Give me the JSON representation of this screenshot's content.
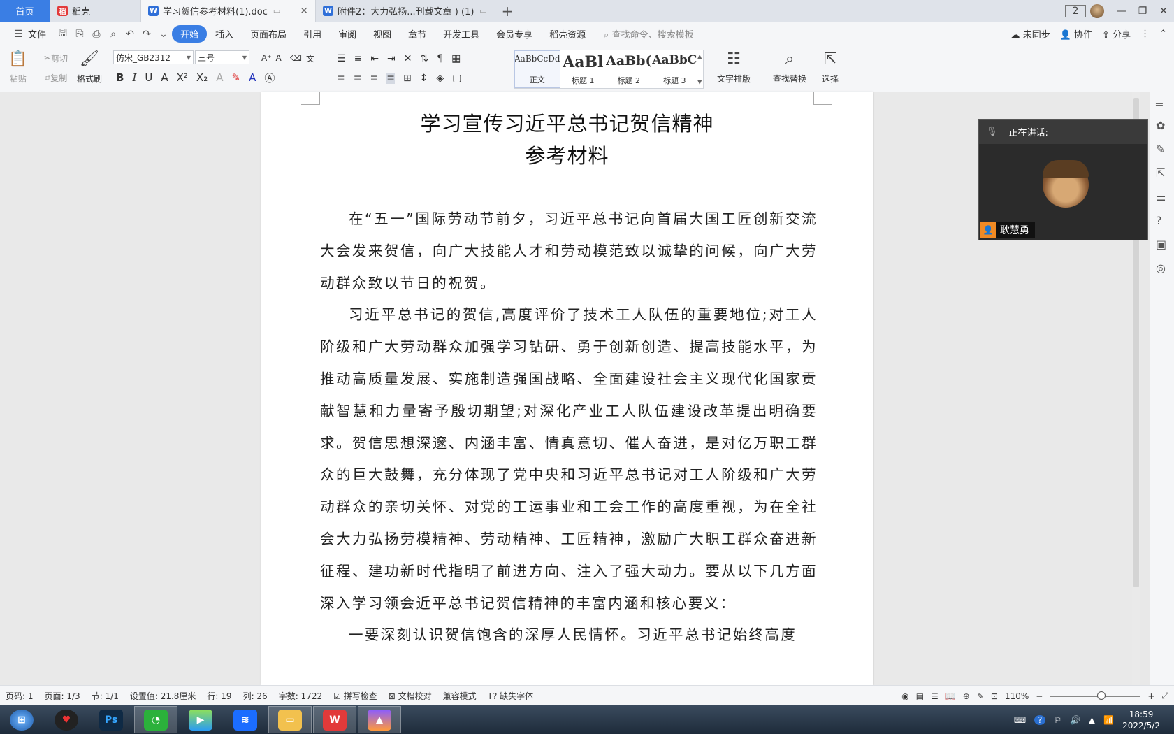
{
  "tabs": {
    "home": "首页",
    "daoke": "稻壳",
    "active_doc": "学习贺信参考材料(1).doc",
    "second_doc": "附件2：大力弘扬...刊载文章 ) (1)"
  },
  "window": {
    "badge": "2"
  },
  "menu": {
    "file": "文件",
    "start": "开始",
    "insert": "插入",
    "layout": "页面布局",
    "reference": "引用",
    "review": "审阅",
    "view": "视图",
    "chapter": "章节",
    "devtools": "开发工具",
    "member": "会员专享",
    "daoke_res": "稻壳资源",
    "search_placeholder": "查找命令、搜索模板",
    "unsync": "未同步",
    "collab": "协作",
    "share": "分享"
  },
  "ribbon": {
    "paste": "粘贴",
    "cut": "剪切",
    "copy": "复制",
    "format_painter": "格式刷",
    "font_name": "仿宋_GB2312",
    "font_size": "三号",
    "styles": [
      {
        "sample": "AaBbCcDd",
        "label": "正文"
      },
      {
        "sample": "AaBl",
        "label": "标题 1"
      },
      {
        "sample": "AaBb(",
        "label": "标题 2"
      },
      {
        "sample": "AaBbC",
        "label": "标题 3"
      }
    ],
    "text_layout": "文字排版",
    "find_replace": "查找替换",
    "select": "选择"
  },
  "document": {
    "title_line1": "学习宣传习近平总书记贺信精神",
    "title_line2": "参考材料",
    "paragraphs": [
      "在“五一”国际劳动节前夕，习近平总书记向首届大国工匠创新交流大会发来贺信，向广大技能人才和劳动模范致以诚挚的问候，向广大劳动群众致以节日的祝贺。",
      "习近平总书记的贺信,高度评价了技术工人队伍的重要地位;对工人阶级和广大劳动群众加强学习钻研、勇于创新创造、提高技能水平，为推动高质量发展、实施制造强国战略、全面建设社会主义现代化国家贡献智慧和力量寄予殷切期望;对深化产业工人队伍建设改革提出明确要求。贺信思想深邃、内涵丰富、情真意切、催人奋进，是对亿万职工群众的巨大鼓舞，充分体现了党中央和习近平总书记对工人阶级和广大劳动群众的亲切关怀、对党的工运事业和工会工作的高度重视，为在全社会大力弘扬劳模精神、劳动精神、工匠精神，激励广大职工群众奋进新征程、建功新时代指明了前进方向、注入了强大动力。要从以下几方面深入学习领会近平总书记贺信精神的丰富内涵和核心要义：",
      "一要深刻认识贺信饱含的深厚人民情怀。习近平总书记始终高度"
    ]
  },
  "meeting": {
    "speaking_label": "正在讲话:",
    "speaker_name": "耿慧勇"
  },
  "status": {
    "page_num": "页码: 1",
    "pages": "页面: 1/3",
    "section": "节: 1/1",
    "setting": "设置值: 21.8厘米",
    "row": "行: 19",
    "col": "列: 26",
    "word_count": "字数: 1722",
    "spell_check": "拼写检查",
    "proofread": "文档校对",
    "compat_mode": "兼容模式",
    "missing_font": "缺失字体",
    "zoom": "110%"
  },
  "taskbar": {
    "time": "18:59",
    "date": "2022/5/2"
  },
  "colors": {
    "accent": "#3a7ee4",
    "taskbar": "#2a3a4c"
  }
}
